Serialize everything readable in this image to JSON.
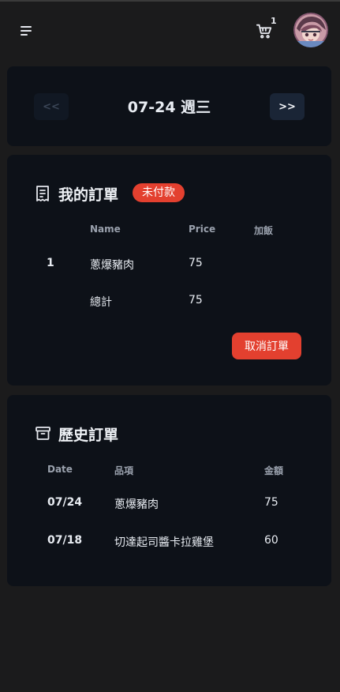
{
  "header": {
    "cart_count": "1",
    "menu_icon": "menu-icon",
    "cart_icon": "cart-icon"
  },
  "date_nav": {
    "prev_label": "<<",
    "date_label": "07-24 週三",
    "next_label": ">>"
  },
  "my_order": {
    "title": "我的訂單",
    "status_badge": "未付款",
    "columns": [
      "Name",
      "Price",
      "加飯"
    ],
    "rows": [
      {
        "index": "1",
        "name": "蔥爆豬肉",
        "price": "75",
        "extra_rice": ""
      }
    ],
    "total_label": "總計",
    "total_value": "75",
    "cancel_label": "取消訂單"
  },
  "history": {
    "title": "歷史訂單",
    "columns": [
      "Date",
      "品項",
      "金額"
    ],
    "rows": [
      {
        "date": "07/24",
        "item": "蔥爆豬肉",
        "amount": "75"
      },
      {
        "date": "07/18",
        "item": "切達起司醬卡拉雞堡",
        "amount": "60"
      }
    ]
  },
  "colors": {
    "background": "#1b1b1c",
    "card": "#0d1118",
    "danger": "#e3402f"
  }
}
